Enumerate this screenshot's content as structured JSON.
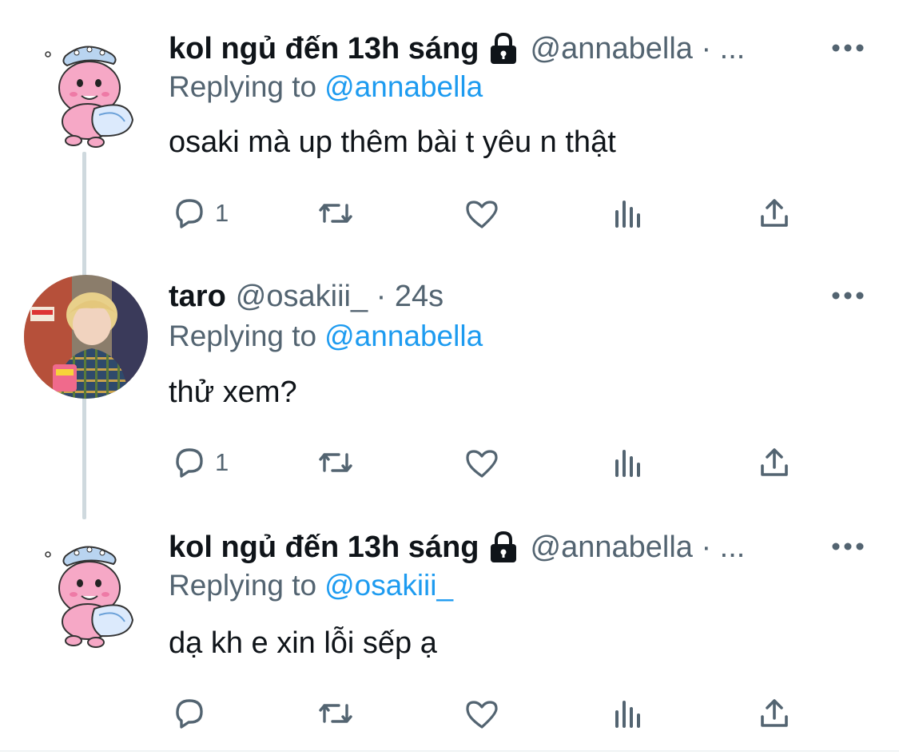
{
  "tweets": [
    {
      "display_name": "kol ngủ đến 13h sáng",
      "locked": true,
      "handle": "@annabella · ...",
      "replying_prefix": "Replying to",
      "replying_to": "@annabella",
      "text": "osaki mà up thêm bài t yêu n thật",
      "reply_count": "1",
      "avatar": "pink-bear-pillow-sticker"
    },
    {
      "display_name": "taro",
      "locked": false,
      "handle": "@osakiii_ · 24s",
      "replying_prefix": "Replying to",
      "replying_to": "@annabella",
      "text": "thử xem?",
      "reply_count": "1",
      "avatar": "person-photo"
    },
    {
      "display_name": "kol ngủ đến 13h sáng",
      "locked": true,
      "handle": "@annabella · ...",
      "replying_prefix": "Replying to",
      "replying_to": "@osakiii_",
      "text": "dạ kh e xin lỗi sếp ạ",
      "reply_count": "",
      "avatar": "pink-bear-pillow-sticker"
    }
  ],
  "icons": {
    "reply": "reply-icon",
    "retweet": "retweet-icon",
    "like": "heart-icon",
    "views": "analytics-icon",
    "share": "share-icon",
    "more": "more-icon",
    "lock": "lock-icon"
  },
  "colors": {
    "text": "#0f1419",
    "secondary": "#536471",
    "link": "#1d9bf0",
    "thread_line": "#cfd9de",
    "avatar_pink": "#f4a1c0"
  }
}
